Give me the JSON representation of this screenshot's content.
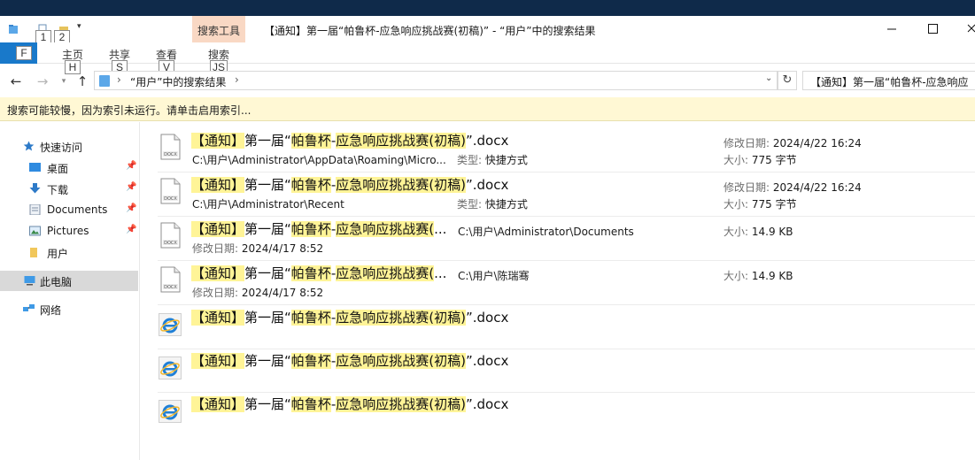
{
  "window": {
    "title": "【通知】第一届“帕鲁杯-应急响应挑战赛(初稿)” - “用户”中的搜索结果",
    "context_tab_group": "搜索工具"
  },
  "quick_access_toolbar": {
    "keytips": [
      "1",
      "2"
    ]
  },
  "ribbon": {
    "file_tab": "文件",
    "file_keytip": "F",
    "tabs": [
      {
        "label": "主页",
        "keytip": "H"
      },
      {
        "label": "共享",
        "keytip": "S"
      },
      {
        "label": "查看",
        "keytip": "V"
      },
      {
        "label": "搜索",
        "keytip": "JS"
      }
    ]
  },
  "address": {
    "path": "“用户”中的搜索结果",
    "search_text": "【通知】第一届“帕鲁杯-应急响应"
  },
  "infobar": {
    "text": "搜索可能较慢，因为索引未运行。请单击启用索引..."
  },
  "nav": {
    "items": [
      {
        "label": "快速访问"
      },
      {
        "label": "桌面"
      },
      {
        "label": "下载"
      },
      {
        "label": "Documents"
      },
      {
        "label": "Pictures"
      },
      {
        "label": "用户"
      },
      {
        "label": "此电脑"
      },
      {
        "label": "网络"
      }
    ]
  },
  "results": [
    {
      "icon": "docx-shortcut-icon",
      "name": {
        "p1": "【通知】",
        "p2": "第一届“",
        "p3": "帕鲁杯",
        "p4": "-",
        "p5": "应急响应挑战赛(初稿)",
        "p6": "”.docx"
      },
      "path": "C:\\用户\\Administrator\\AppData\\Roaming\\Micro...",
      "type_label": "类型:",
      "type_value": "快捷方式",
      "date_label": "修改日期:",
      "date_value": "2024/4/22 16:24",
      "size_label": "大小:",
      "size_value": "775 字节"
    },
    {
      "icon": "docx-shortcut-icon",
      "name": {
        "p1": "【通知】",
        "p2": "第一届“",
        "p3": "帕鲁杯",
        "p4": "-",
        "p5": "应急响应挑战赛(初稿)",
        "p6": "”.docx"
      },
      "path": "C:\\用户\\Administrator\\Recent",
      "type_label": "类型:",
      "type_value": "快捷方式",
      "date_label": "修改日期:",
      "date_value": "2024/4/22 16:24",
      "size_label": "大小:",
      "size_value": "775 字节"
    },
    {
      "icon": "docx-file-icon",
      "name": {
        "p1": "【通知】",
        "p2": "第一届“",
        "p3": "帕鲁杯",
        "p4": "-",
        "p5": "应急响应挑战赛(",
        "p6": "..."
      },
      "location": "C:\\用户\\Administrator\\Documents",
      "date_label": "修改日期:",
      "date_value": "2024/4/17 8:52",
      "size_label": "大小:",
      "size_value": "14.9 KB"
    },
    {
      "icon": "docx-file-icon",
      "name": {
        "p1": "【通知】",
        "p2": "第一届“",
        "p3": "帕鲁杯",
        "p4": "-",
        "p5": "应急响应挑战赛(",
        "p6": "..."
      },
      "location": "C:\\用户\\陈瑞骞",
      "date_label": "修改日期:",
      "date_value": "2024/4/17 8:52",
      "size_label": "大小:",
      "size_value": "14.9 KB"
    },
    {
      "icon": "internet-explorer-icon",
      "name": {
        "p1": "【通知】",
        "p2": "第一届“",
        "p3": "帕鲁杯",
        "p4": "-",
        "p5": "应急响应挑战赛(初稿)",
        "p6": "”.docx"
      }
    },
    {
      "icon": "internet-explorer-icon",
      "name": {
        "p1": "【通知】",
        "p2": "第一届“",
        "p3": "帕鲁杯",
        "p4": "-",
        "p5": "应急响应挑战赛(初稿)",
        "p6": "”.docx"
      }
    },
    {
      "icon": "internet-explorer-icon",
      "name": {
        "p1": "【通知】",
        "p2": "第一届“",
        "p3": "帕鲁杯",
        "p4": "-",
        "p5": "应急响应挑战赛(初稿)",
        "p6": "”.docx"
      }
    }
  ]
}
